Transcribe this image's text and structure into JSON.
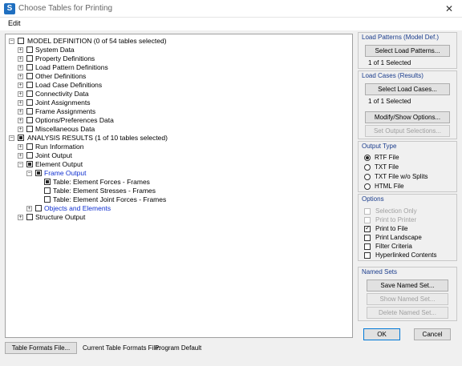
{
  "window": {
    "title": "Choose Tables for Printing",
    "close_glyph": "✕"
  },
  "menu": {
    "edit": "Edit"
  },
  "tree": {
    "model_definition": {
      "label": "MODEL DEFINITION  (0 of 54 tables selected)",
      "items": [
        "System Data",
        "Property Definitions",
        "Load Pattern Definitions",
        "Other Definitions",
        "Load Case Definitions",
        "Connectivity Data",
        "Joint Assignments",
        "Frame Assignments",
        "Options/Preferences Data",
        "Miscellaneous Data"
      ]
    },
    "analysis_results": {
      "label": "ANALYSIS RESULTS  (1 of 10 tables selected)",
      "run_information": "Run Information",
      "joint_output": "Joint Output",
      "element_output": "Element Output",
      "frame_output": "Frame Output",
      "tables": [
        "Table:  Element Forces - Frames",
        "Table:  Element Stresses - Frames",
        "Table:  Element Joint Forces - Frames"
      ],
      "objects_and_elements": "Objects and Elements",
      "structure_output": "Structure Output"
    }
  },
  "load_patterns": {
    "title": "Load Patterns (Model Def.)",
    "button": "Select Load Patterns...",
    "status": "1 of 1 Selected"
  },
  "load_cases": {
    "title": "Load Cases (Results)",
    "button": "Select Load Cases...",
    "status": "1 of 1 Selected",
    "modify_button": "Modify/Show Options...",
    "set_output_button": "Set Output Selections..."
  },
  "output_type": {
    "title": "Output Type",
    "options": [
      "RTF File",
      "TXT File",
      "TXT File w/o Splits",
      "HTML File"
    ],
    "selected": "RTF File"
  },
  "options": {
    "title": "Options",
    "items": [
      "Selection Only",
      "Print to Printer",
      "Print to File",
      "Print Landscape",
      "Filter Criteria",
      "Hyperlinked Contents"
    ]
  },
  "named_sets": {
    "title": "Named Sets",
    "save": "Save Named Set...",
    "show": "Show Named Set...",
    "delete": "Delete Named Set..."
  },
  "dialog": {
    "ok": "OK",
    "cancel": "Cancel"
  },
  "footer": {
    "table_formats_button": "Table Formats File...",
    "current_label": "Current Table Formats File:",
    "current_value": "Program Default"
  }
}
